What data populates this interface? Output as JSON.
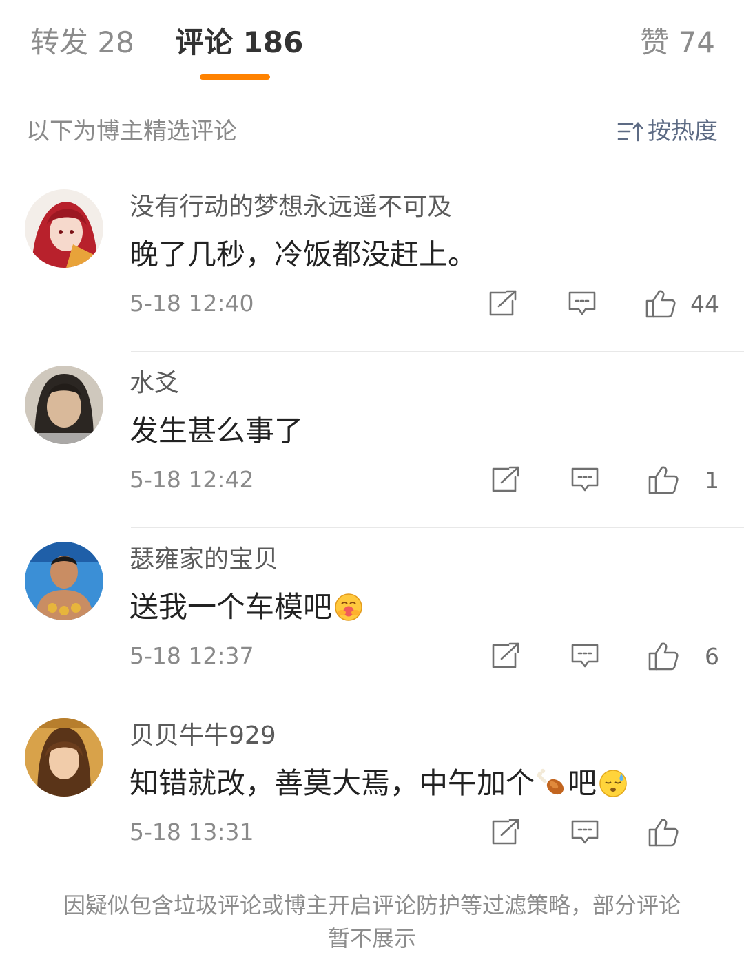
{
  "tabs": {
    "forward": {
      "label": "转发",
      "count": "28"
    },
    "comments": {
      "label": "评论",
      "count": "186"
    },
    "likes": {
      "label": "赞",
      "count": "74"
    }
  },
  "accent_color": "#ff8200",
  "subheader": {
    "featured_note": "以下为博主精选评论",
    "sort_label": "按热度"
  },
  "comments": [
    {
      "username": "没有行动的梦想永远遥不可及",
      "text": "晚了几秒，冷饭都没赶上。",
      "time": "5-18 12:40",
      "likes": "44"
    },
    {
      "username": "水爻",
      "text": "发生甚么事了",
      "time": "5-18 12:42",
      "likes": "1"
    },
    {
      "username": "瑟雍家的宝贝",
      "text_before": "送我一个车模吧",
      "emoji": "hugging-face-emoji",
      "time": "5-18 12:37",
      "likes": "6"
    },
    {
      "username": "贝贝牛牛929",
      "text_before": "知错就改，善莫大焉，中午加个",
      "emoji_mid": "drumstick-emoji",
      "text_after": "吧",
      "emoji": "sleepy-sweat-face-emoji",
      "time": "5-18 13:31",
      "likes": ""
    }
  ],
  "footer": {
    "note": "因疑似包含垃圾评论或博主开启评论防护等过滤策略，部分评论暂不展示"
  }
}
